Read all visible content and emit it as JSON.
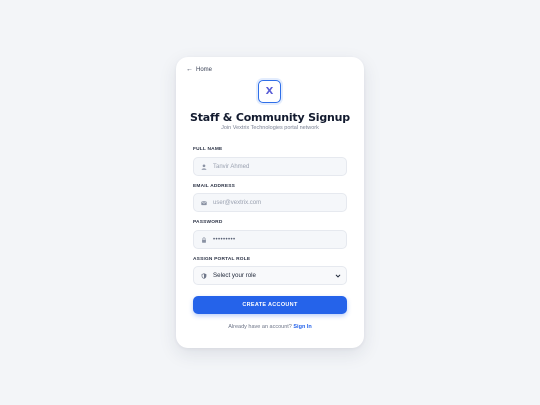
{
  "back_link": {
    "label": "Home",
    "icon": "arrow-left-icon"
  },
  "logo": {
    "letter": "X",
    "border_color": "#2f6fe8"
  },
  "title": "Staff & Community Signup",
  "subtitle": "Join Vextrix Technologies portal network",
  "fields": {
    "full_name": {
      "label": "FULL NAME",
      "placeholder": "Tanvir Ahmed",
      "icon": "user-icon"
    },
    "email": {
      "label": "EMAIL ADDRESS",
      "placeholder": "user@vextrix.com",
      "icon": "envelope-icon"
    },
    "password": {
      "label": "PASSWORD",
      "value": "•••••••••",
      "icon": "lock-icon"
    },
    "role": {
      "label": "ASSIGN PORTAL ROLE",
      "selected": "Select your role",
      "icon": "shield-icon"
    }
  },
  "submit": {
    "label": "CREATE ACCOUNT",
    "color": "#2563ea"
  },
  "footer": {
    "prompt": "Already have an account?",
    "link": "Sign In"
  }
}
